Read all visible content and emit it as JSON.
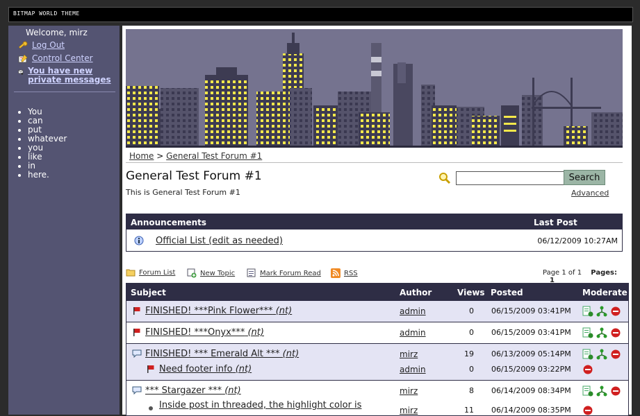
{
  "window": {
    "title": "BITMAP WORLD THEME"
  },
  "sidebar": {
    "welcome": "Welcome, mirz",
    "links": [
      {
        "label": "Log Out",
        "icon": "key-icon"
      },
      {
        "label": "Control Center",
        "icon": "pencil-card-icon"
      },
      {
        "label": "You have new private messages",
        "icon": "mail-icon"
      }
    ],
    "list": [
      "You",
      "can",
      "put",
      "whatever",
      "you",
      "like",
      "in",
      "here."
    ]
  },
  "breadcrumb": {
    "home": "Home",
    "separator": ">",
    "forum": "General Test Forum #1"
  },
  "forum": {
    "title": "General Test Forum #1",
    "description": "This is General Test Forum #1"
  },
  "search": {
    "value": "",
    "button": "Search",
    "advanced": "Advanced"
  },
  "announcements": {
    "header": "Announcements",
    "last_post_header": "Last Post",
    "items": [
      {
        "title": "Official List (edit as needed)",
        "date": "06/12/2009 10:27AM"
      }
    ]
  },
  "toolbar": {
    "forum_list": "Forum List",
    "new_topic": "New Topic",
    "mark_read": "Mark Forum Read",
    "rss": "RSS",
    "page_info": "Page 1 of 1",
    "pages_label": "Pages:",
    "current_page": "1"
  },
  "topics": {
    "headers": {
      "subject": "Subject",
      "author": "Author",
      "views": "Views",
      "posted": "Posted",
      "moderate": "Moderate"
    },
    "rows": [
      {
        "subject": "FINISHED! ***Pink Flower***",
        "nt": "(nt)",
        "author": "admin",
        "views": "0",
        "posted": "06/15/2009 03:41PM"
      },
      {
        "subject": "FINISHED! ***Onyx***",
        "nt": "(nt)",
        "author": "admin",
        "views": "0",
        "posted": "06/15/2009 03:41PM"
      },
      {
        "subject": "FINISHED! *** Emerald Alt ***",
        "nt": "(nt)",
        "author": "mirz",
        "views": "19",
        "posted": "06/13/2009 05:14PM"
      },
      {
        "subject": "Need footer info",
        "nt": "(nt)",
        "author": "admin",
        "views": "0",
        "posted": "06/15/2009 03:22PM"
      },
      {
        "subject": "*** Stargazer ***",
        "nt": "(nt)",
        "author": "mirz",
        "views": "8",
        "posted": "06/14/2009 08:34PM"
      },
      {
        "subject": "Inside post in threaded, the highlight color is",
        "nt": "",
        "author": "mirz",
        "views": "11",
        "posted": "06/14/2009 08:35PM"
      }
    ]
  },
  "colors": {
    "sidebar_bg": "#545472",
    "header_bg": "#2e2d45",
    "row_highlight": "#e4e4f4",
    "banner_bg": "#75738f"
  }
}
